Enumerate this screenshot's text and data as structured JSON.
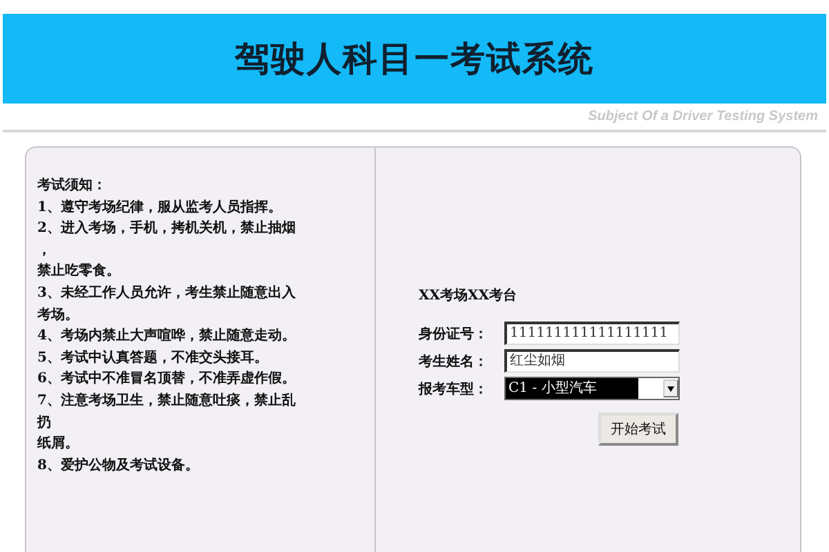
{
  "header": {
    "title": "驾驶人科目一考试系统",
    "subtitle": "Subject Of a Driver Testing System"
  },
  "notice": {
    "heading": "考试须知：",
    "lines": [
      "1、遵守考场纪律，服从监考人员指挥。",
      "2、进入考场，手机，拷机关机，禁止抽烟",
      "，",
      "禁止吃零食。",
      "3、未经工作人员允许，考生禁止随意出入",
      "考场。",
      "4、考场内禁止大声喧哗，禁止随意走动。",
      "5、考试中认真答题，不准交头接耳。",
      "6、考试中不准冒名顶替，不准弄虚作假。",
      "7、注意考场卫生，禁止随意吐痰，禁止乱",
      "扔",
      "纸屑。",
      "8、爱护公物及考试设备。"
    ]
  },
  "login": {
    "station": "XX考场XX考台",
    "fields": [
      {
        "kind": "text",
        "label": "身份证号：",
        "value": "111111111111111111"
      },
      {
        "kind": "text",
        "label": "考生姓名：",
        "value": "红尘如烟"
      },
      {
        "kind": "select",
        "label": "报考车型：",
        "value": "C1 - 小型汽车",
        "selected": true
      }
    ],
    "button": "开始考试"
  }
}
